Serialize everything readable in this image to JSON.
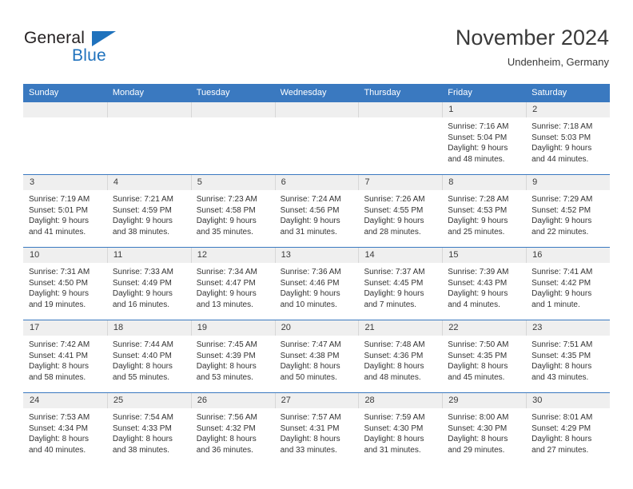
{
  "brand": {
    "word_general": "General",
    "word_blue": "Blue",
    "triangle_color": "#1f72bd"
  },
  "header": {
    "title": "November 2024",
    "subtitle": "Undenheim, Germany",
    "accent_color": "#3a79c0",
    "band_color": "#efefef"
  },
  "weekdays": [
    "Sunday",
    "Monday",
    "Tuesday",
    "Wednesday",
    "Thursday",
    "Friday",
    "Saturday"
  ],
  "weeks": [
    [
      {
        "day": "",
        "empty": true
      },
      {
        "day": "",
        "empty": true
      },
      {
        "day": "",
        "empty": true
      },
      {
        "day": "",
        "empty": true
      },
      {
        "day": "",
        "empty": true
      },
      {
        "day": "1",
        "sunrise": "Sunrise: 7:16 AM",
        "sunset": "Sunset: 5:04 PM",
        "daylight1": "Daylight: 9 hours",
        "daylight2": "and 48 minutes."
      },
      {
        "day": "2",
        "sunrise": "Sunrise: 7:18 AM",
        "sunset": "Sunset: 5:03 PM",
        "daylight1": "Daylight: 9 hours",
        "daylight2": "and 44 minutes."
      }
    ],
    [
      {
        "day": "3",
        "sunrise": "Sunrise: 7:19 AM",
        "sunset": "Sunset: 5:01 PM",
        "daylight1": "Daylight: 9 hours",
        "daylight2": "and 41 minutes."
      },
      {
        "day": "4",
        "sunrise": "Sunrise: 7:21 AM",
        "sunset": "Sunset: 4:59 PM",
        "daylight1": "Daylight: 9 hours",
        "daylight2": "and 38 minutes."
      },
      {
        "day": "5",
        "sunrise": "Sunrise: 7:23 AM",
        "sunset": "Sunset: 4:58 PM",
        "daylight1": "Daylight: 9 hours",
        "daylight2": "and 35 minutes."
      },
      {
        "day": "6",
        "sunrise": "Sunrise: 7:24 AM",
        "sunset": "Sunset: 4:56 PM",
        "daylight1": "Daylight: 9 hours",
        "daylight2": "and 31 minutes."
      },
      {
        "day": "7",
        "sunrise": "Sunrise: 7:26 AM",
        "sunset": "Sunset: 4:55 PM",
        "daylight1": "Daylight: 9 hours",
        "daylight2": "and 28 minutes."
      },
      {
        "day": "8",
        "sunrise": "Sunrise: 7:28 AM",
        "sunset": "Sunset: 4:53 PM",
        "daylight1": "Daylight: 9 hours",
        "daylight2": "and 25 minutes."
      },
      {
        "day": "9",
        "sunrise": "Sunrise: 7:29 AM",
        "sunset": "Sunset: 4:52 PM",
        "daylight1": "Daylight: 9 hours",
        "daylight2": "and 22 minutes."
      }
    ],
    [
      {
        "day": "10",
        "sunrise": "Sunrise: 7:31 AM",
        "sunset": "Sunset: 4:50 PM",
        "daylight1": "Daylight: 9 hours",
        "daylight2": "and 19 minutes."
      },
      {
        "day": "11",
        "sunrise": "Sunrise: 7:33 AM",
        "sunset": "Sunset: 4:49 PM",
        "daylight1": "Daylight: 9 hours",
        "daylight2": "and 16 minutes."
      },
      {
        "day": "12",
        "sunrise": "Sunrise: 7:34 AM",
        "sunset": "Sunset: 4:47 PM",
        "daylight1": "Daylight: 9 hours",
        "daylight2": "and 13 minutes."
      },
      {
        "day": "13",
        "sunrise": "Sunrise: 7:36 AM",
        "sunset": "Sunset: 4:46 PM",
        "daylight1": "Daylight: 9 hours",
        "daylight2": "and 10 minutes."
      },
      {
        "day": "14",
        "sunrise": "Sunrise: 7:37 AM",
        "sunset": "Sunset: 4:45 PM",
        "daylight1": "Daylight: 9 hours",
        "daylight2": "and 7 minutes."
      },
      {
        "day": "15",
        "sunrise": "Sunrise: 7:39 AM",
        "sunset": "Sunset: 4:43 PM",
        "daylight1": "Daylight: 9 hours",
        "daylight2": "and 4 minutes."
      },
      {
        "day": "16",
        "sunrise": "Sunrise: 7:41 AM",
        "sunset": "Sunset: 4:42 PM",
        "daylight1": "Daylight: 9 hours",
        "daylight2": "and 1 minute."
      }
    ],
    [
      {
        "day": "17",
        "sunrise": "Sunrise: 7:42 AM",
        "sunset": "Sunset: 4:41 PM",
        "daylight1": "Daylight: 8 hours",
        "daylight2": "and 58 minutes."
      },
      {
        "day": "18",
        "sunrise": "Sunrise: 7:44 AM",
        "sunset": "Sunset: 4:40 PM",
        "daylight1": "Daylight: 8 hours",
        "daylight2": "and 55 minutes."
      },
      {
        "day": "19",
        "sunrise": "Sunrise: 7:45 AM",
        "sunset": "Sunset: 4:39 PM",
        "daylight1": "Daylight: 8 hours",
        "daylight2": "and 53 minutes."
      },
      {
        "day": "20",
        "sunrise": "Sunrise: 7:47 AM",
        "sunset": "Sunset: 4:38 PM",
        "daylight1": "Daylight: 8 hours",
        "daylight2": "and 50 minutes."
      },
      {
        "day": "21",
        "sunrise": "Sunrise: 7:48 AM",
        "sunset": "Sunset: 4:36 PM",
        "daylight1": "Daylight: 8 hours",
        "daylight2": "and 48 minutes."
      },
      {
        "day": "22",
        "sunrise": "Sunrise: 7:50 AM",
        "sunset": "Sunset: 4:35 PM",
        "daylight1": "Daylight: 8 hours",
        "daylight2": "and 45 minutes."
      },
      {
        "day": "23",
        "sunrise": "Sunrise: 7:51 AM",
        "sunset": "Sunset: 4:35 PM",
        "daylight1": "Daylight: 8 hours",
        "daylight2": "and 43 minutes."
      }
    ],
    [
      {
        "day": "24",
        "sunrise": "Sunrise: 7:53 AM",
        "sunset": "Sunset: 4:34 PM",
        "daylight1": "Daylight: 8 hours",
        "daylight2": "and 40 minutes."
      },
      {
        "day": "25",
        "sunrise": "Sunrise: 7:54 AM",
        "sunset": "Sunset: 4:33 PM",
        "daylight1": "Daylight: 8 hours",
        "daylight2": "and 38 minutes."
      },
      {
        "day": "26",
        "sunrise": "Sunrise: 7:56 AM",
        "sunset": "Sunset: 4:32 PM",
        "daylight1": "Daylight: 8 hours",
        "daylight2": "and 36 minutes."
      },
      {
        "day": "27",
        "sunrise": "Sunrise: 7:57 AM",
        "sunset": "Sunset: 4:31 PM",
        "daylight1": "Daylight: 8 hours",
        "daylight2": "and 33 minutes."
      },
      {
        "day": "28",
        "sunrise": "Sunrise: 7:59 AM",
        "sunset": "Sunset: 4:30 PM",
        "daylight1": "Daylight: 8 hours",
        "daylight2": "and 31 minutes."
      },
      {
        "day": "29",
        "sunrise": "Sunrise: 8:00 AM",
        "sunset": "Sunset: 4:30 PM",
        "daylight1": "Daylight: 8 hours",
        "daylight2": "and 29 minutes."
      },
      {
        "day": "30",
        "sunrise": "Sunrise: 8:01 AM",
        "sunset": "Sunset: 4:29 PM",
        "daylight1": "Daylight: 8 hours",
        "daylight2": "and 27 minutes."
      }
    ]
  ]
}
